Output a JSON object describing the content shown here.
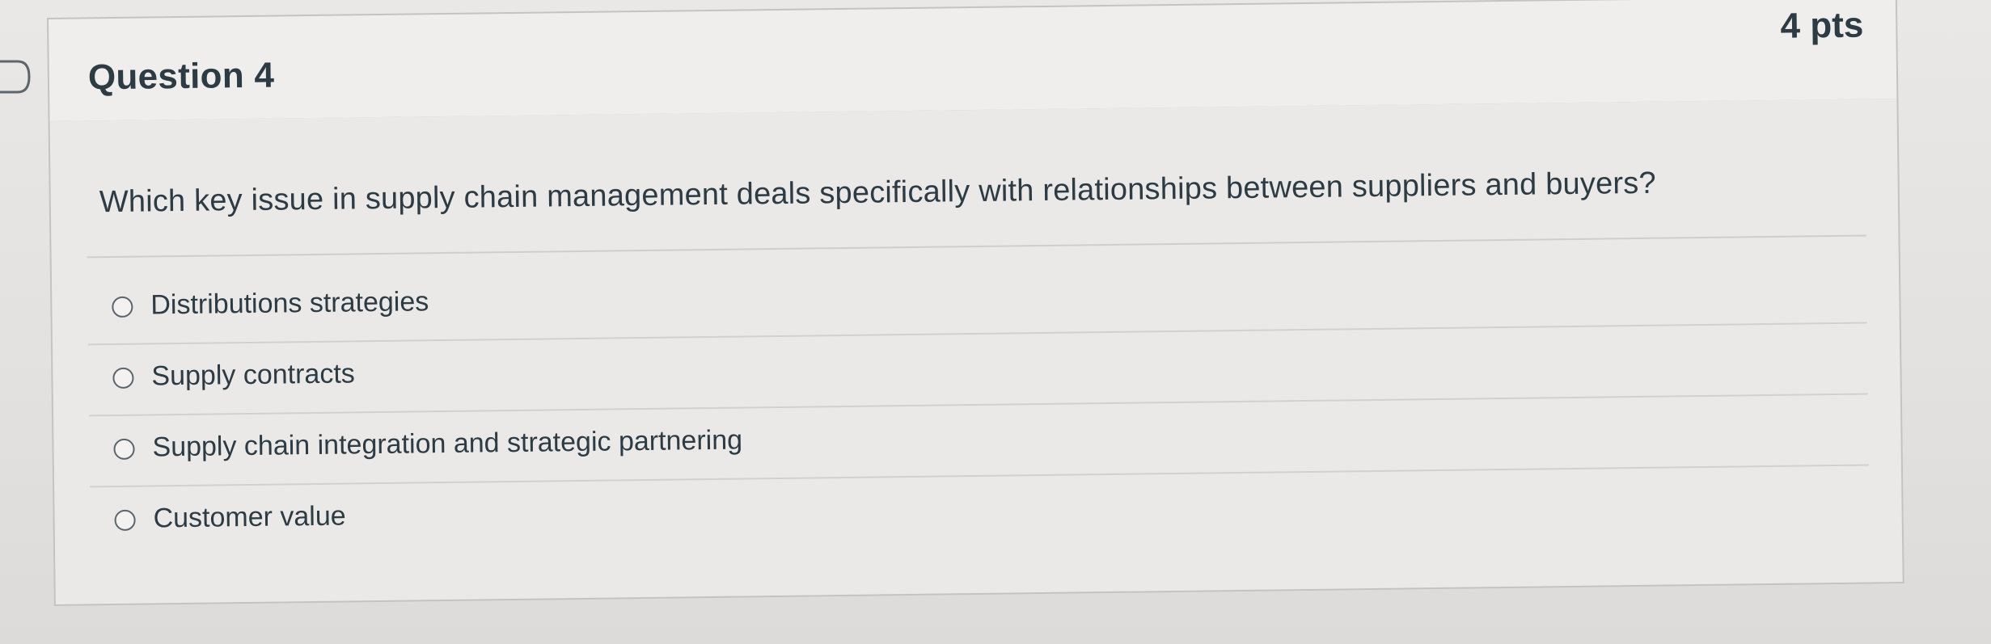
{
  "question": {
    "title": "Question 4",
    "points": "4 pts",
    "text": "Which key issue in supply chain management deals specifically with relationships between suppliers and buyers?",
    "answers": [
      {
        "label": "Distributions strategies",
        "selected": false
      },
      {
        "label": "Supply contracts",
        "selected": false
      },
      {
        "label": "Supply chain integration and strategic partnering",
        "selected": false
      },
      {
        "label": "Customer value",
        "selected": false
      }
    ]
  },
  "colors": {
    "text": "#2d3b45",
    "header_bg": "#efeeec",
    "body_bg": "#eae9e7",
    "border": "#c4c3c1"
  },
  "icons": {
    "flag": "bookmark-flag-icon",
    "radio": "radio-button-icon"
  }
}
